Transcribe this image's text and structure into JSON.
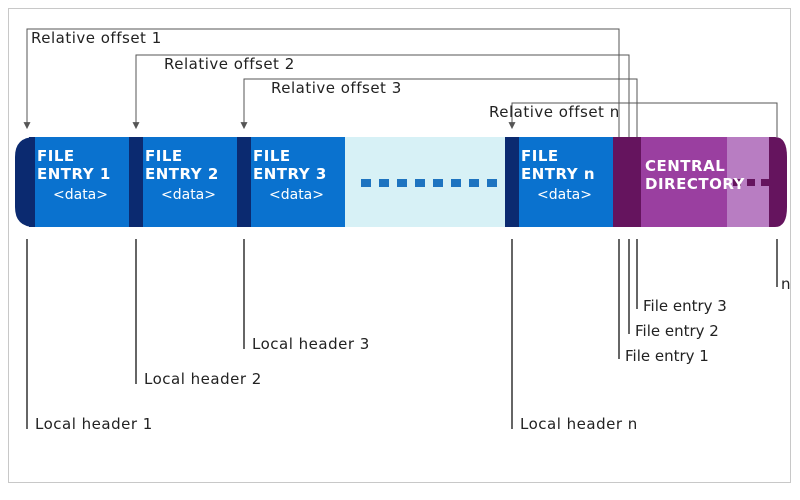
{
  "colors": {
    "darkBlue": "#0b2a70",
    "blue": "#0a72cf",
    "lightBlueGap": "#d7f1f6",
    "purpleDark": "#65145e",
    "purple": "#9a3fa0",
    "purpleLight": "#b87dc2",
    "frame": "#c8c8c8",
    "dashDot": "#1e74c0"
  },
  "offsets": {
    "o1": "Relative offset 1",
    "o2": "Relative offset 2",
    "o3": "Relative offset 3",
    "on": "Relative offset n"
  },
  "entries": {
    "e1_l1": "FILE",
    "e1_l2": "ENTRY 1",
    "e2_l1": "FILE",
    "e2_l2": "ENTRY 2",
    "e3_l1": "FILE",
    "e3_l2": "ENTRY 3",
    "en_l1": "FILE",
    "en_l2": "ENTRY n",
    "data": "<data>"
  },
  "central": {
    "l1": "CENTRAL",
    "l2": "DIRECTORY"
  },
  "headers": {
    "h1": "Local header 1",
    "h2": "Local header 2",
    "h3": "Local header 3",
    "hn": "Local header n"
  },
  "cd_entries": {
    "fe1": "File entry 1",
    "fe2": "File entry 2",
    "fe3": "File entry 3",
    "n": "n"
  },
  "chart_data": {
    "type": "diagram",
    "title": "",
    "layout": "horizontal-bar",
    "segments": [
      {
        "kind": "local-header",
        "index": 1,
        "label": "Local header 1",
        "pointer_from": "Relative offset 1"
      },
      {
        "kind": "file-entry",
        "index": 1,
        "label": "FILE ENTRY 1",
        "sub": "<data>"
      },
      {
        "kind": "local-header",
        "index": 2,
        "label": "Local header 2",
        "pointer_from": "Relative offset 2"
      },
      {
        "kind": "file-entry",
        "index": 2,
        "label": "FILE ENTRY 2",
        "sub": "<data>"
      },
      {
        "kind": "local-header",
        "index": 3,
        "label": "Local header 3",
        "pointer_from": "Relative offset 3"
      },
      {
        "kind": "file-entry",
        "index": 3,
        "label": "FILE ENTRY 3",
        "sub": "<data>"
      },
      {
        "kind": "ellipsis"
      },
      {
        "kind": "local-header",
        "index": "n",
        "label": "Local header n",
        "pointer_from": "Relative offset n"
      },
      {
        "kind": "file-entry",
        "index": "n",
        "label": "FILE ENTRY n",
        "sub": "<data>"
      },
      {
        "kind": "central-directory",
        "label": "CENTRAL DIRECTORY",
        "entries": [
          "File entry 1",
          "File entry 2",
          "File entry 3",
          "…",
          "n"
        ],
        "offsets_point_to": [
          "Local header 1",
          "Local header 2",
          "Local header 3",
          "Local header n"
        ]
      }
    ]
  }
}
